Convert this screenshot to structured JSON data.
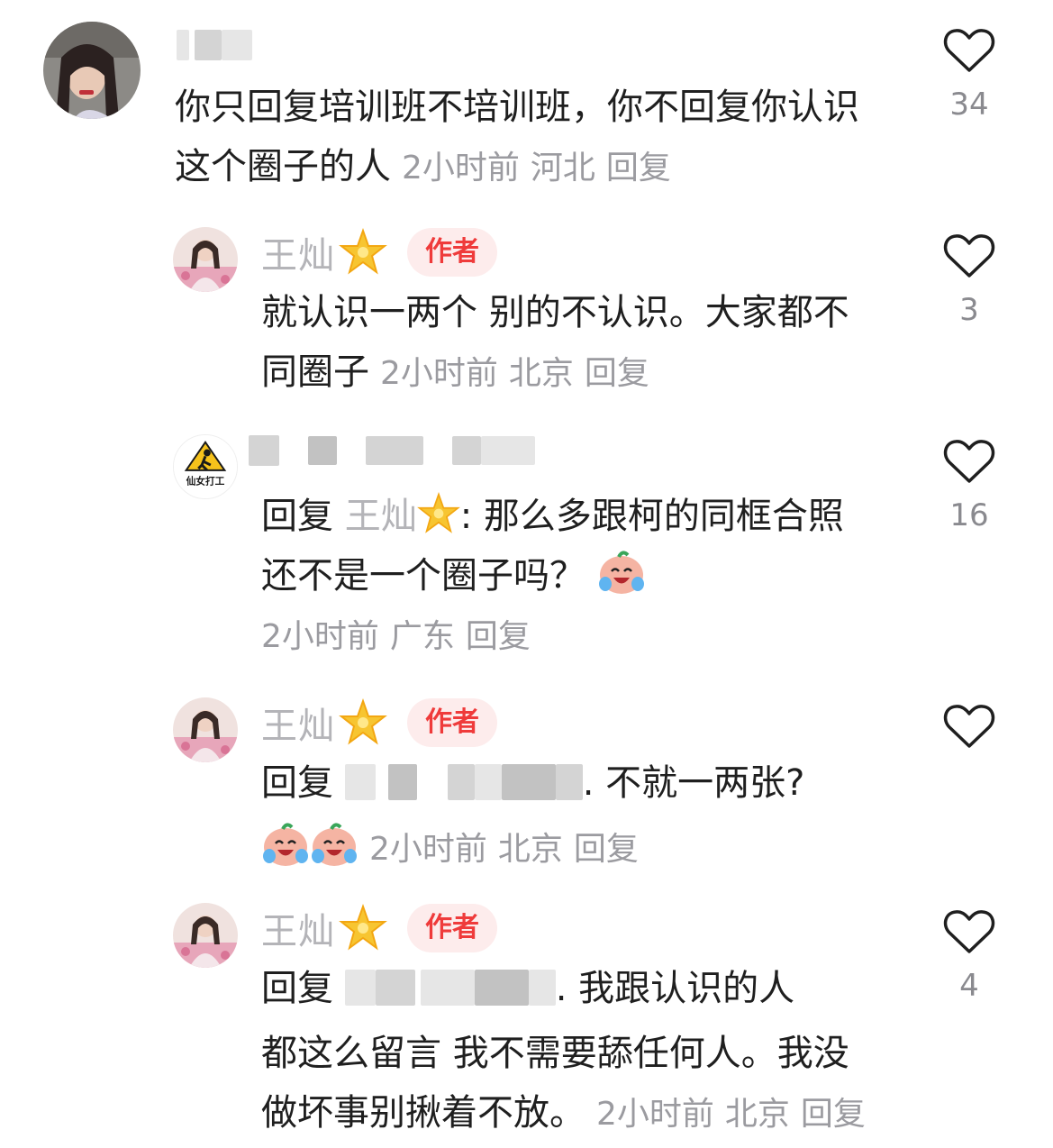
{
  "comments": [
    {
      "body_lines": [
        "你只回复培训班不培训班，你不回复你认识",
        "这个圈子的人"
      ],
      "time": "2小时前",
      "location": "河北",
      "reply_label": "回复",
      "likes": "34"
    },
    {
      "username": "王灿",
      "author_badge": "作者",
      "body_lines": [
        "就认识一两个 别的不认识。大家都不",
        "同圈子"
      ],
      "time": "2小时前",
      "location": "北京",
      "reply_label": "回复",
      "likes": "3"
    },
    {
      "avatar_text": "仙女打工",
      "reply_prefix": "回复",
      "reply_to": "王灿",
      "body_lines": [
        ": 那么多跟柯的同框合照",
        "还不是一个圈子吗？"
      ],
      "time": "2小时前",
      "location": "广东",
      "reply_label": "回复",
      "likes": "16"
    },
    {
      "username": "王灿",
      "author_badge": "作者",
      "reply_prefix": "回复",
      "body_lines": [
        ". 不就一两张?"
      ],
      "time": "2小时前",
      "location": "北京",
      "reply_label": "回复",
      "likes": ""
    },
    {
      "username": "王灿",
      "author_badge": "作者",
      "reply_prefix": "回复",
      "body_lines": [
        ". 我跟认识的人",
        "都这么留言 我不需要舔任何人。我没",
        "做坏事别揪着不放。"
      ],
      "time": "2小时前",
      "location": "北京",
      "reply_label": "回复",
      "likes": "4"
    }
  ],
  "colors": {
    "username": "#b4b4b8",
    "badge_bg": "#fdecec",
    "badge_text": "#ef3b3b",
    "meta": "#9b9ba0",
    "like_icon": "#1f1f1f"
  },
  "icons": {
    "like": "heart-outline-icon",
    "author_mark": "star-icon",
    "emoji": "crying-laughing-face-icon"
  }
}
